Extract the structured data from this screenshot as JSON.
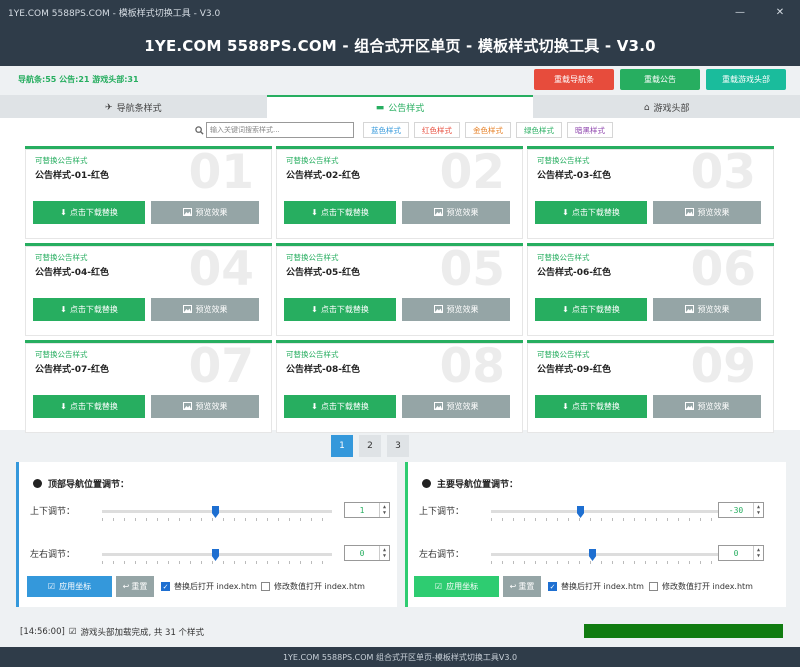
{
  "window": {
    "title": "1YE.COM 5588PS.COM - 模板样式切换工具 - V3.0",
    "minimize": "—",
    "close": "✕"
  },
  "header": {
    "title": "1YE.COM 5588PS.COM - 组合式开区单页 - 模板样式切换工具 - V3.0"
  },
  "stats": {
    "text": "导航条:55  公告:21  游戏头部:31"
  },
  "reload_buttons": [
    {
      "label": "重载导航条",
      "color": "#e74c3c"
    },
    {
      "label": "重载公告",
      "color": "#27ae60"
    },
    {
      "label": "重载游戏头部",
      "color": "#1abc9c"
    }
  ],
  "tabs": [
    {
      "label": "导航条样式",
      "icon": "✈"
    },
    {
      "label": "公告样式",
      "icon": "▬"
    },
    {
      "label": "游戏头部",
      "icon": "⌂"
    }
  ],
  "search": {
    "placeholder": "输入关键词搜索样式...",
    "icon": "🔍"
  },
  "filters": [
    {
      "label": "蓝色样式",
      "color": "#3498db"
    },
    {
      "label": "红色样式",
      "color": "#e74c3c"
    },
    {
      "label": "金色样式",
      "color": "#e67e22"
    },
    {
      "label": "绿色样式",
      "color": "#27ae60"
    },
    {
      "label": "暗黑样式",
      "color": "#8e44ad"
    }
  ],
  "card_subtitle": "可替换公告样式",
  "card_download": "点击下载替换",
  "card_preview": "预览效果",
  "cards": [
    {
      "num": "01",
      "name": "公告样式-01-红色"
    },
    {
      "num": "02",
      "name": "公告样式-02-红色"
    },
    {
      "num": "03",
      "name": "公告样式-03-红色"
    },
    {
      "num": "04",
      "name": "公告样式-04-红色"
    },
    {
      "num": "05",
      "name": "公告样式-05-红色"
    },
    {
      "num": "06",
      "name": "公告样式-06-红色"
    },
    {
      "num": "07",
      "name": "公告样式-07-红色"
    },
    {
      "num": "08",
      "name": "公告样式-08-红色"
    },
    {
      "num": "09",
      "name": "公告样式-09-红色"
    }
  ],
  "pages": [
    "1",
    "2",
    "3"
  ],
  "panels": {
    "left": {
      "title": "顶部导航位置调节：",
      "v_label": "上下调节：",
      "v_value": "1",
      "h_label": "左右调节：",
      "h_value": "0",
      "apply": "应用坐标",
      "reset": "重置",
      "chk1": "替换后打开 index.htm",
      "chk2": "修改数值打开 index.htm"
    },
    "right": {
      "title": "主要导航位置调节：",
      "v_label": "上下调节：",
      "v_value": "-30",
      "h_label": "左右调节：",
      "h_value": "0",
      "apply": "应用坐标",
      "reset": "重置",
      "chk1": "替换后打开 index.htm",
      "chk2": "修改数值打开 index.htm"
    }
  },
  "status": {
    "time": "[14:56:00]",
    "message": "游戏头部加载完成, 共 31 个样式",
    "progress": 1.0
  },
  "footer": {
    "text": "1YE.COM 5588PS.COM 组合式开区单页-模板样式切换工具V3.0"
  }
}
